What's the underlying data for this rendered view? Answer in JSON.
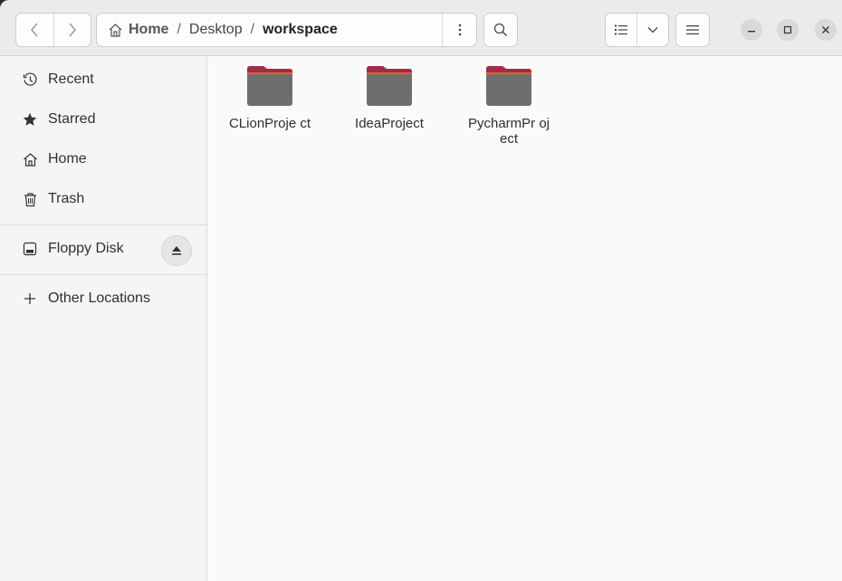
{
  "header": {
    "path": {
      "home_label": "Home",
      "segments": [
        "Desktop",
        "workspace"
      ]
    }
  },
  "sidebar": {
    "items": [
      {
        "label": "Recent",
        "icon": "clock-icon"
      },
      {
        "label": "Starred",
        "icon": "star-icon"
      },
      {
        "label": "Home",
        "icon": "home-icon"
      },
      {
        "label": "Trash",
        "icon": "trash-icon"
      }
    ],
    "devices": [
      {
        "label": "Floppy Disk",
        "icon": "floppy-disk-icon",
        "eject_icon": "eject-icon"
      }
    ],
    "other": {
      "label": "Other Locations",
      "icon": "plus-icon"
    }
  },
  "content": {
    "items": [
      {
        "name": "CLionProje ct",
        "icon": "folder-icon"
      },
      {
        "name": "IdeaProject",
        "icon": "folder-icon"
      },
      {
        "name": "PycharmPr oject",
        "icon": "folder-icon"
      }
    ]
  },
  "colors": {
    "folder_body": "#6e6e6e",
    "folder_tab": "#a5294a",
    "folder_edge": "#e65c2c"
  }
}
